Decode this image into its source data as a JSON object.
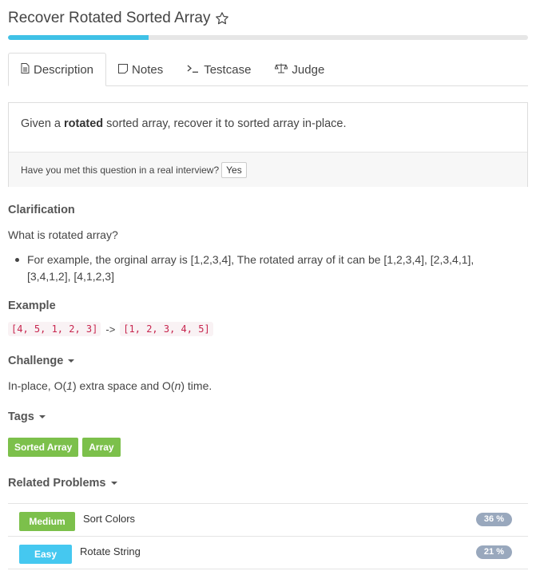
{
  "problem": {
    "title": "Recover Rotated Sorted Array",
    "progress_percent": 27
  },
  "tabs": [
    {
      "label": "Description",
      "icon": "document-icon",
      "active": true
    },
    {
      "label": "Notes",
      "icon": "note-icon",
      "active": false
    },
    {
      "label": "Testcase",
      "icon": "terminal-icon",
      "active": false
    },
    {
      "label": "Judge",
      "icon": "scale-icon",
      "active": false
    }
  ],
  "description": {
    "prefix": "Given a ",
    "bold": "rotated",
    "suffix": " sorted array, recover it to sorted array in-place.",
    "interview_question": "Have you met this question in a real interview?",
    "yes_label": "Yes"
  },
  "clarification": {
    "heading": "Clarification",
    "question": "What is rotated array?",
    "bullet": "For example, the orginal array is [1,2,3,4], The rotated array of it can be [1,2,3,4], [2,3,4,1], [3,4,1,2], [4,1,2,3]"
  },
  "example": {
    "heading": "Example",
    "input": "[4, 5, 1, 2, 3]",
    "arrow": "->",
    "output": "[1, 2, 3, 4, 5]"
  },
  "challenge": {
    "heading": "Challenge",
    "text_1": "In-place, O(",
    "italic_1": "1",
    "text_2": ") extra space and O(",
    "italic_2": "n",
    "text_3": ") time."
  },
  "tags": {
    "heading": "Tags",
    "items": [
      "Sorted Array",
      "Array"
    ]
  },
  "related": {
    "heading": "Related Problems",
    "items": [
      {
        "difficulty": "Medium",
        "name": "Sort Colors",
        "percent": "36 %",
        "color": "#7cc04b"
      },
      {
        "difficulty": "Easy",
        "name": "Rotate String",
        "percent": "21 %",
        "color": "#45c8f0"
      }
    ]
  }
}
